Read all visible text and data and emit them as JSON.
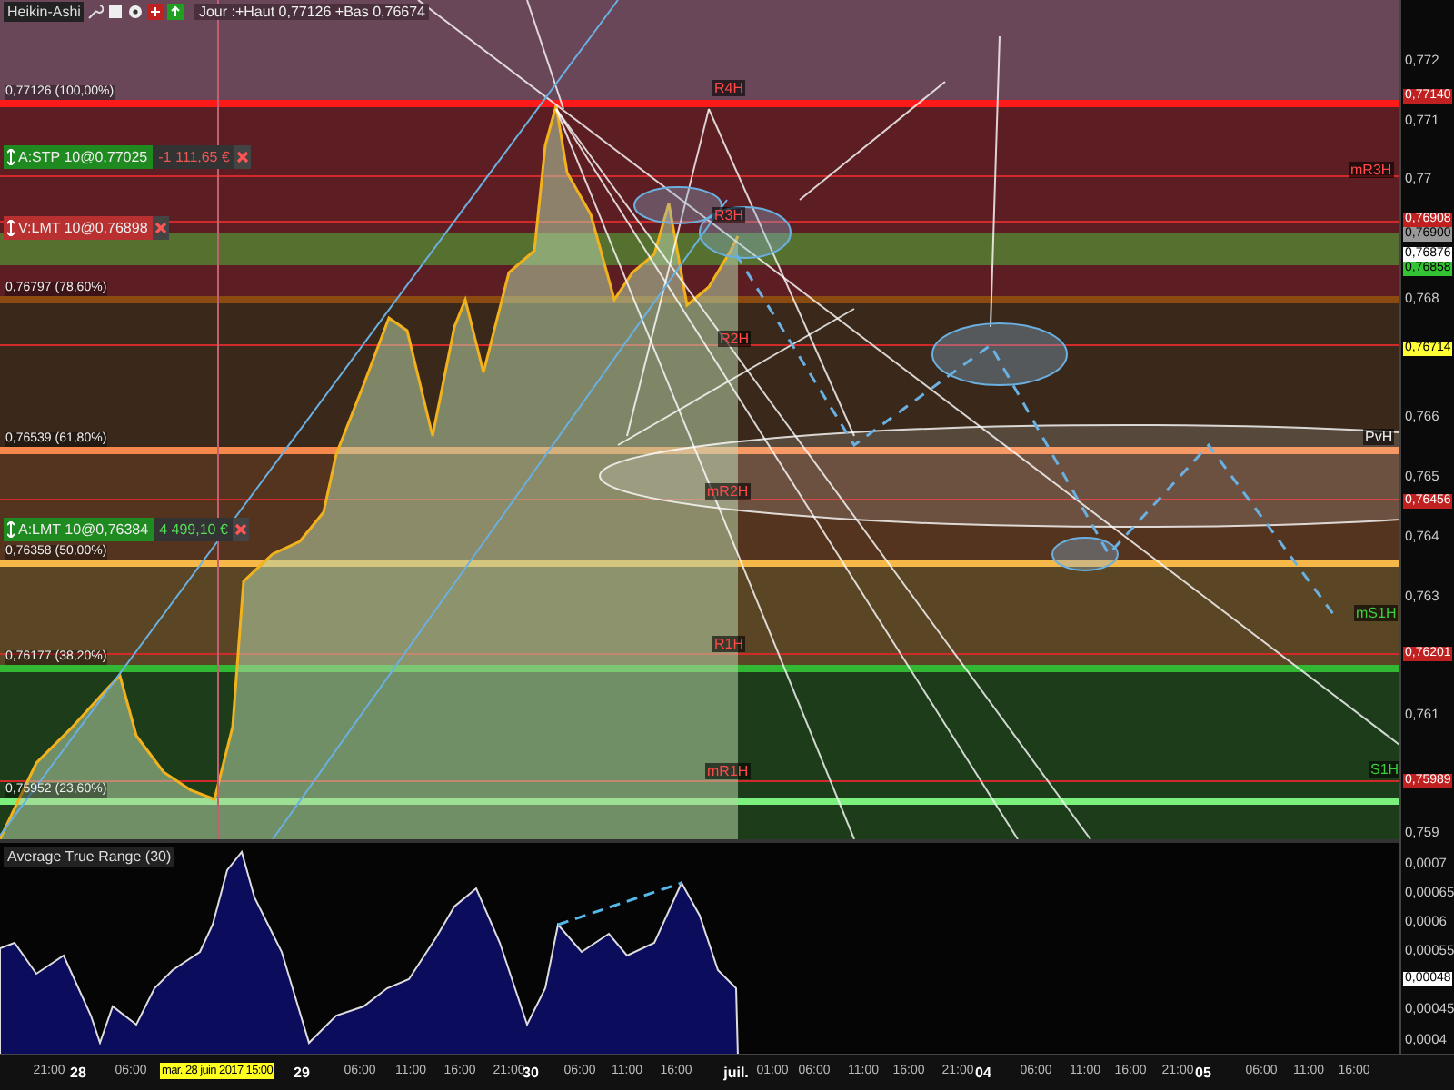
{
  "header": {
    "chart_type": "Heikin-Ashi",
    "info": "Jour :+Haut 0,77126 +Bas 0,76674"
  },
  "chart": {
    "fib_levels": [
      {
        "label": "0,77126 (100,00%)",
        "color": "#ff1a1a"
      },
      {
        "label": "0,76797 (78,60%)",
        "color": "#8a4a10"
      },
      {
        "label": "0,76539 (61,80%)",
        "color": "#f5884a"
      },
      {
        "label": "0,76358 (50,00%)",
        "color": "#f7b84a"
      },
      {
        "label": "0,76177 (38,20%)",
        "color": "#33b833"
      },
      {
        "label": "0,75952 (23,60%)",
        "color": "#7cf07c"
      }
    ],
    "orders": [
      {
        "label": "A:STP 10@0,77025",
        "pnl": "-1 111,65 €",
        "color": "#1f8a1f"
      },
      {
        "label": "V:LMT 10@0,76898",
        "color": "#b83030"
      },
      {
        "label": "A:LMT 10@0,76384",
        "pnl": "4 499,10 €",
        "color": "#1f8a1f"
      }
    ],
    "pivot_labels": [
      {
        "label": "R4H",
        "kind": "resistance"
      },
      {
        "label": "mR3H",
        "kind": "resistance"
      },
      {
        "label": "R3H",
        "kind": "resistance"
      },
      {
        "label": "R2H",
        "kind": "resistance"
      },
      {
        "label": "PvH",
        "kind": "pivot"
      },
      {
        "label": "mR2H",
        "kind": "resistance"
      },
      {
        "label": "mS1H",
        "kind": "support"
      },
      {
        "label": "R1H",
        "kind": "resistance"
      },
      {
        "label": "mR1H",
        "kind": "resistance"
      },
      {
        "label": "S1H",
        "kind": "support"
      }
    ]
  },
  "price_axis": {
    "ticks": [
      "0,772",
      "0,771",
      "0,77",
      "0,768",
      "0,766",
      "0,765",
      "0,764",
      "0,763",
      "0,761",
      "0,759"
    ],
    "tags": [
      {
        "label": "0,77140",
        "color": "#c02020"
      },
      {
        "label": "0,76908",
        "color": "#c02020"
      },
      {
        "label": "0,76900",
        "color": "#999999"
      },
      {
        "label": "0,76876",
        "color": "#ffffff"
      },
      {
        "label": "0,76858",
        "color": "#33c433"
      },
      {
        "label": "0,76714",
        "color": "#ffff33"
      },
      {
        "label": "0,76456",
        "color": "#c02020"
      },
      {
        "label": "0,76201",
        "color": "#c02020"
      },
      {
        "label": "0,75989",
        "color": "#c02020"
      }
    ]
  },
  "indicator": {
    "title": "Average True Range (30)",
    "ticks": [
      "0,0007",
      "0,00065",
      "0,0006",
      "0,00055",
      "0,00045",
      "0,0004"
    ],
    "tag": "0,00048"
  },
  "time_axis": {
    "cursor_label": "mar. 28 juin 2017 15:00",
    "labels": [
      {
        "label": "21:00",
        "kind": "hour"
      },
      {
        "label": "28",
        "kind": "day"
      },
      {
        "label": "06:00",
        "kind": "hour"
      },
      {
        "label": "29",
        "kind": "day"
      },
      {
        "label": "06:00",
        "kind": "hour"
      },
      {
        "label": "11:00",
        "kind": "hour"
      },
      {
        "label": "16:00",
        "kind": "hour"
      },
      {
        "label": "21:00",
        "kind": "hour"
      },
      {
        "label": "30",
        "kind": "day"
      },
      {
        "label": "06:00",
        "kind": "hour"
      },
      {
        "label": "11:00",
        "kind": "hour"
      },
      {
        "label": "16:00",
        "kind": "hour"
      },
      {
        "label": "juil.",
        "kind": "day"
      },
      {
        "label": "01:00",
        "kind": "hour"
      },
      {
        "label": "06:00",
        "kind": "hour"
      },
      {
        "label": "11:00",
        "kind": "hour"
      },
      {
        "label": "16:00",
        "kind": "hour"
      },
      {
        "label": "21:00",
        "kind": "hour"
      },
      {
        "label": "04",
        "kind": "day"
      },
      {
        "label": "06:00",
        "kind": "hour"
      },
      {
        "label": "11:00",
        "kind": "hour"
      },
      {
        "label": "16:00",
        "kind": "hour"
      },
      {
        "label": "21:00",
        "kind": "hour"
      },
      {
        "label": "05",
        "kind": "day"
      },
      {
        "label": "06:00",
        "kind": "hour"
      },
      {
        "label": "11:00",
        "kind": "hour"
      },
      {
        "label": "16:00",
        "kind": "hour"
      }
    ]
  }
}
